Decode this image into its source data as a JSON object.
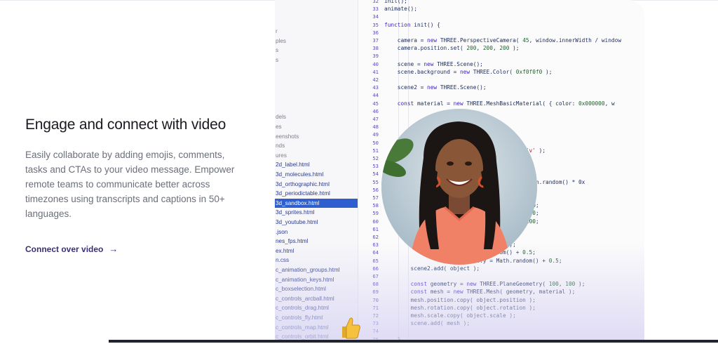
{
  "heading": "Engage and connect with video",
  "body": "Easily collaborate by adding emojis, comments, tasks and CTAs to your video message. Empower remote teams to communicate better across timezones using transcripts and captions in 50+ languages.",
  "cta": {
    "label": "Connect over video",
    "arrow": "→"
  },
  "file_tree": [
    "r",
    "ples",
    "s",
    "s",
    "",
    "",
    "",
    "",
    "",
    "dels",
    "es",
    "eenshots",
    "nds",
    "ures",
    "2d_label.html",
    "3d_molecules.html",
    "3d_orthographic.html",
    "3d_periodictable.html",
    "3d_sandbox.html",
    "3d_sprites.html",
    "3d_youtube.html",
    ".json",
    "nes_fps.html",
    "ex.html",
    "n.css",
    "c_animation_groups.html",
    "c_animation_keys.html",
    "c_boxselection.html",
    "c_controls_arcball.html",
    "c_controls_drag.html",
    "c_controls_fly.html",
    "c_controls_map.html",
    "c_controls_orbit.html",
    "c_controls_pointerlock.html",
    "c_controls_trackball.html"
  ],
  "selected_file": "3d_sandbox.html",
  "line_numbers": [
    "32",
    "33",
    "34",
    "35",
    "36",
    "37",
    "38",
    "39",
    "40",
    "41",
    "42",
    "43",
    "44",
    "45",
    "46",
    "47",
    "48",
    "49",
    "50",
    "51",
    "52",
    "53",
    "54",
    "55",
    "56",
    "57",
    "58",
    "59",
    "60",
    "61",
    "62",
    "63",
    "64",
    "65",
    "66",
    "67",
    "68",
    "69",
    "70",
    "71",
    "72",
    "73",
    "74",
    "75"
  ],
  "code_lines": [
    "init();",
    "animate();",
    "",
    "function init() {",
    "",
    "    camera = new THREE.PerspectiveCamera( 45, window.innerWidth / window",
    "    camera.position.set( 200, 200, 200 );",
    "",
    "    scene = new THREE.Scene();",
    "    scene.background = new THREE.Color( 0xf0f0f0 );",
    "",
    "    scene2 = new THREE.Scene();",
    "",
    "    const material = new THREE.MeshBasicMaterial( { color: 0x000000, w",
    "",
    "",
    "",
    "                              ++ ) {",
    "",
    "                          createElement( 'div' );",
    "                          px';",
    "                          px';",
    "                          < 5 ) ? 0.5 : 1;",
    "                          new THREE.Color( Math.random() * 0x",
    "",
    "                          ect( element );",
    "                          random() * 200 - 100;",
    "                          random() * 200 - 100;",
    "                          random() * 200 - 100;",
    "                          .random();",
    "                          .random();",
    "                          Math.random();",
    "                          Math.random() + 0.5;",
    "                          ale.y = Math.random() + 0.5;",
    "        scene2.add( object );",
    "",
    "        const geometry = new THREE.PlaneGeometry( 100, 100 );",
    "        const mesh = new THREE.Mesh( geometry, material );",
    "        mesh.position.copy( object.position );",
    "        mesh.rotation.copy( object.rotation );",
    "        mesh.scale.copy( object.scale );",
    "        scene.add( mesh );",
    "",
    "    }"
  ],
  "icons": {
    "avatar": "woman-smiling-avatar",
    "thumb": "thumbs-up-icon",
    "arrow": "arrow-right-icon"
  },
  "colors": {
    "accent": "#3a2f7a",
    "selection": "#2f5ecf",
    "line_numbers": "#5a4fb6"
  }
}
